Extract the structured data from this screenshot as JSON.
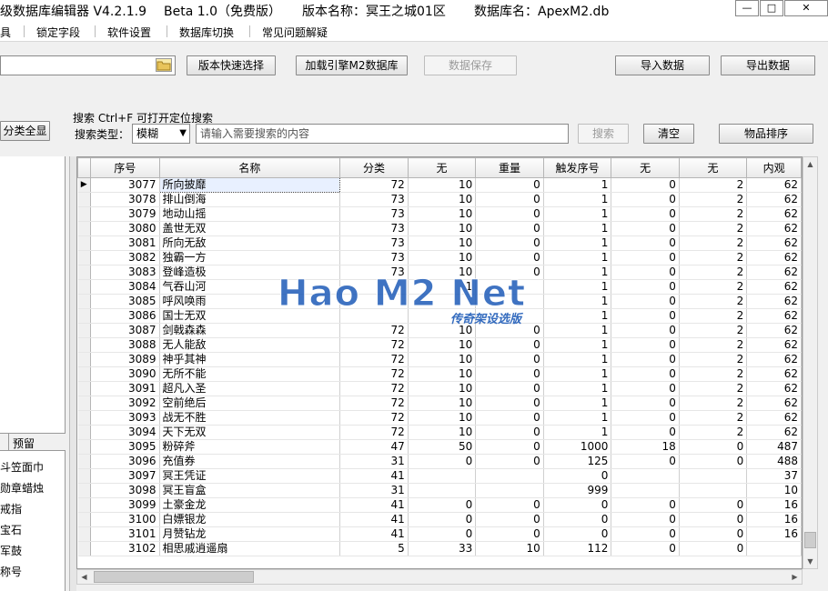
{
  "title": {
    "app": "级数据库编辑器 V4.2.1.9",
    "beta": "Beta 1.0（免费版）",
    "version": "版本名称：冥王之城01区",
    "db": "数据库名：ApexM2.db"
  },
  "window_buttons": [
    "—",
    "□",
    "✕"
  ],
  "menu": [
    "具",
    "锁定字段",
    "软件设置",
    "数据库切换",
    "常见问题解疑"
  ],
  "toolbar": {
    "path_value": "",
    "version_quick": "版本快速选择",
    "load_engine": "加载引擎M2数据库",
    "save_data": "数据保存",
    "import_data": "导入数据",
    "export_data": "导出数据"
  },
  "search": {
    "category_all": "分类全显",
    "hint": "搜索  Ctrl+F 可打开定位搜索",
    "type_label": "搜索类型：",
    "type_value": "模糊",
    "placeholder": "请输入需要搜索的内容",
    "search_btn": "搜索",
    "clear_btn": "清空",
    "sort_btn": "物品排序"
  },
  "left_panel": {
    "tab_label": "预留",
    "items": [
      "斗笠面巾",
      "勋章蜡烛",
      "戒指",
      "宝石",
      "军鼓",
      "称号"
    ]
  },
  "table": {
    "columns": [
      "序号",
      "名称",
      "分类",
      "无",
      "重量",
      "触发序号",
      "无",
      "无",
      "内观"
    ],
    "rows": [
      [
        "3077",
        "所向披靡",
        "72",
        "10",
        "0",
        "1",
        "0",
        "2",
        "62"
      ],
      [
        "3078",
        "排山倒海",
        "73",
        "10",
        "0",
        "1",
        "0",
        "2",
        "62"
      ],
      [
        "3079",
        "地动山摇",
        "73",
        "10",
        "0",
        "1",
        "0",
        "2",
        "62"
      ],
      [
        "3080",
        "盖世无双",
        "73",
        "10",
        "0",
        "1",
        "0",
        "2",
        "62"
      ],
      [
        "3081",
        "所向无敌",
        "73",
        "10",
        "0",
        "1",
        "0",
        "2",
        "62"
      ],
      [
        "3082",
        "独霸一方",
        "73",
        "10",
        "0",
        "1",
        "0",
        "2",
        "62"
      ],
      [
        "3083",
        "登峰造极",
        "73",
        "10",
        "0",
        "1",
        "0",
        "2",
        "62"
      ],
      [
        "3084",
        "气吞山河",
        "",
        "1",
        "",
        "1",
        "0",
        "2",
        "62"
      ],
      [
        "3085",
        "呼风唤雨",
        "",
        "",
        "",
        "1",
        "0",
        "2",
        "62"
      ],
      [
        "3086",
        "国士无双",
        "",
        "",
        "",
        "1",
        "0",
        "2",
        "62"
      ],
      [
        "3087",
        "剑戟森森",
        "72",
        "10",
        "0",
        "1",
        "0",
        "2",
        "62"
      ],
      [
        "3088",
        "无人能敌",
        "72",
        "10",
        "0",
        "1",
        "0",
        "2",
        "62"
      ],
      [
        "3089",
        "神乎其神",
        "72",
        "10",
        "0",
        "1",
        "0",
        "2",
        "62"
      ],
      [
        "3090",
        "无所不能",
        "72",
        "10",
        "0",
        "1",
        "0",
        "2",
        "62"
      ],
      [
        "3091",
        "超凡入圣",
        "72",
        "10",
        "0",
        "1",
        "0",
        "2",
        "62"
      ],
      [
        "3092",
        "空前绝后",
        "72",
        "10",
        "0",
        "1",
        "0",
        "2",
        "62"
      ],
      [
        "3093",
        "战无不胜",
        "72",
        "10",
        "0",
        "1",
        "0",
        "2",
        "62"
      ],
      [
        "3094",
        "天下无双",
        "72",
        "10",
        "0",
        "1",
        "0",
        "2",
        "62"
      ],
      [
        "3095",
        "粉碎斧",
        "47",
        "50",
        "0",
        "1000",
        "18",
        "0",
        "487"
      ],
      [
        "3096",
        "充值券",
        "31",
        "0",
        "0",
        "125",
        "0",
        "0",
        "488"
      ],
      [
        "3097",
        "冥王凭证",
        "41",
        "",
        "",
        "0",
        "",
        "",
        "37"
      ],
      [
        "3098",
        "冥王盲盒",
        "31",
        "",
        "",
        "999",
        "",
        "",
        "10"
      ],
      [
        "3099",
        "土豪金龙",
        "41",
        "0",
        "0",
        "0",
        "0",
        "0",
        "16"
      ],
      [
        "3100",
        "白嫖银龙",
        "41",
        "0",
        "0",
        "0",
        "0",
        "0",
        "16"
      ],
      [
        "3101",
        "月赞钻龙",
        "41",
        "0",
        "0",
        "0",
        "0",
        "0",
        "16"
      ],
      [
        "3102",
        "相思戚逍遥扇",
        "5",
        "33",
        "10",
        "112",
        "0",
        "0",
        ""
      ]
    ]
  },
  "selected_row_indicator": "▶",
  "watermark": {
    "main": "Hao M2 Net",
    "sub": "传奇架设选版"
  },
  "colors": {
    "watermark_blue": "#1e5bb8",
    "selected_row": "#e8f0ff"
  }
}
